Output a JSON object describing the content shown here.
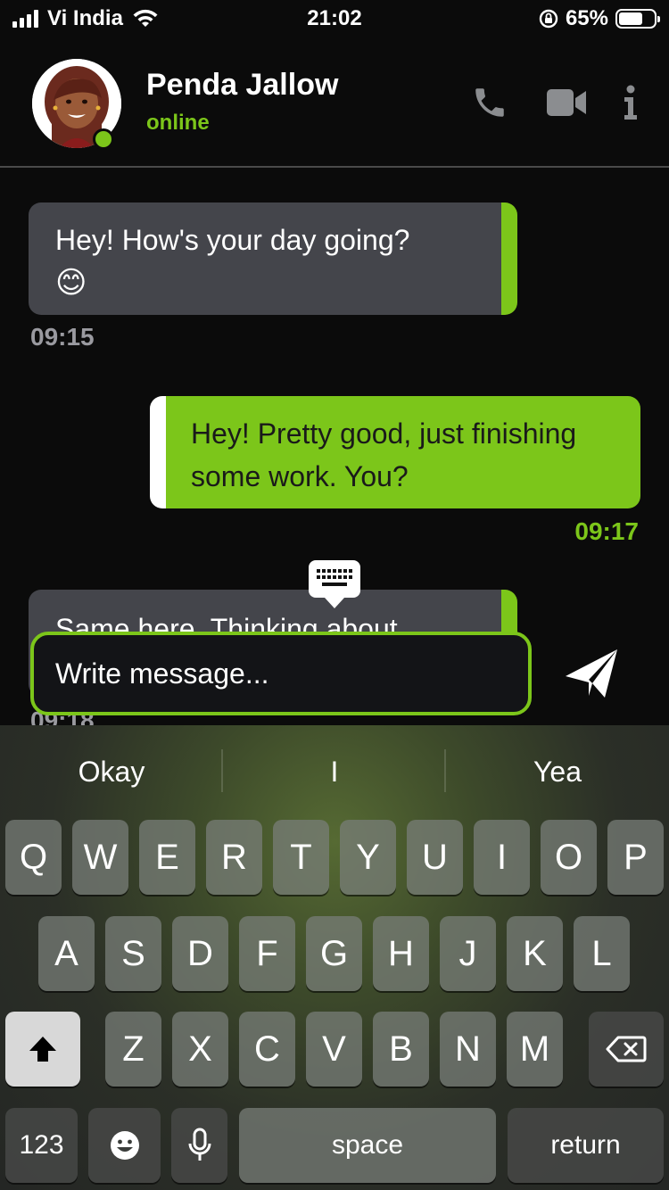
{
  "status_bar": {
    "carrier": "Vi India",
    "time": "21:02",
    "battery_percent": "65%",
    "battery_level": 0.65
  },
  "header": {
    "contact_name": "Penda Jallow",
    "presence": "online",
    "icons": [
      "phone-icon",
      "video-camera-icon",
      "info-icon"
    ]
  },
  "messages": [
    {
      "direction": "incoming",
      "text": "Hey! How's your day going?",
      "emoji": "😊",
      "time": "09:15"
    },
    {
      "direction": "outgoing",
      "text": "Hey! Pretty good, just finishing some work. You?",
      "time": "09:17"
    },
    {
      "direction": "incoming",
      "text": "Same here. Thinking about",
      "time": "09:18"
    }
  ],
  "composer": {
    "placeholder": "Write message..."
  },
  "keyboard": {
    "suggestions": [
      "Okay",
      "I",
      "Yea"
    ],
    "row1": [
      "Q",
      "W",
      "E",
      "R",
      "T",
      "Y",
      "U",
      "I",
      "O",
      "P"
    ],
    "row2": [
      "A",
      "S",
      "D",
      "F",
      "G",
      "H",
      "J",
      "K",
      "L"
    ],
    "row3": [
      "Z",
      "X",
      "C",
      "V",
      "B",
      "N",
      "M"
    ],
    "numbers_label": "123",
    "space_label": "space",
    "return_label": "return"
  },
  "colors": {
    "accent": "#7cc61a",
    "incoming_bubble": "#44454b",
    "background": "#0b0b0b"
  }
}
